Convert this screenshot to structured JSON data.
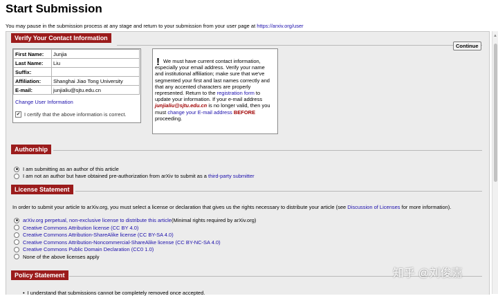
{
  "page_title": "Start Submission",
  "intro": {
    "text": "You may pause in the submission process at any stage and return to your submission from your user page at ",
    "link": "https://arxiv.org/user"
  },
  "continue_label": "Continue",
  "contact": {
    "section_title": "Verify Your Contact Information",
    "rows": [
      {
        "label": "First Name:",
        "value": "Junjia"
      },
      {
        "label": "Last Name:",
        "value": "Liu"
      },
      {
        "label": "Suffix:",
        "value": ""
      },
      {
        "label": "Affiliation:",
        "value": "Shanghai Jiao Tong University"
      },
      {
        "label": "E-mail:",
        "value": "junjialiu@sjtu.edu.cn"
      }
    ],
    "change_link": "Change User Information",
    "certify_label": "I certify that the above information is correct.",
    "certify_checked": true
  },
  "warning": {
    "mark": "!",
    "t1": "We must have current contact information, especially your email address. Verify your name and institutional affiliation; make sure that we've segmented your first and last names correctly and that any accented characters are properly represented. Return to the ",
    "reg_link": "registration form",
    "t2": " to update your information. If your e-mail address ",
    "email": "junjialiu@sjtu.edu.cn",
    "t3": " is no longer valid, then you must ",
    "change_email_link": "change your E-mail address",
    "before": "BEFORE",
    "t4": " proceeding."
  },
  "authorship": {
    "section_title": "Authorship",
    "option1": "I am submitting as an author of this article",
    "option2_text": "I am not an author but have obtained pre-authorization from arXiv to submit as a ",
    "option2_link": "third-party submitter"
  },
  "license": {
    "section_title": "License Statement",
    "intro_text": "In order to submit your article to arXiv.org, you must select a license or declaration that gives us the rights necessary to distribute your article (see ",
    "intro_link": "Discussion of Licenses",
    "intro_end": " for more information).",
    "options": [
      {
        "label": "arXiv.org perpetual, non-exclusive license to distribute this article",
        "note": " (Minimal rights required by arXiv.org)"
      },
      {
        "label": "Creative Commons Attribution license (CC BY 4.0)",
        "note": ""
      },
      {
        "label": "Creative Commons Attribution-ShareAlike license (CC BY-SA 4.0)",
        "note": ""
      },
      {
        "label": "Creative Commons Attribution-Noncommercial-ShareAlike license (CC BY-NC-SA 4.0)",
        "note": ""
      },
      {
        "label": "Creative Commons Public Domain Declaration (CC0 1.0)",
        "note": ""
      },
      {
        "label": "None of the above licenses apply",
        "note": ""
      }
    ]
  },
  "policy": {
    "section_title": "Policy Statement",
    "item": "I understand that submissions cannot be completely removed once accepted."
  },
  "watermark": "知乎 @刘俊嘉",
  "colors": {
    "section_header": "#9b1c1c",
    "link": "#1a0dab",
    "panel": "#ececec",
    "alert": "#a00000"
  },
  "icons": {
    "radio": "radio-icon",
    "checkbox": "checkbox-icon"
  }
}
